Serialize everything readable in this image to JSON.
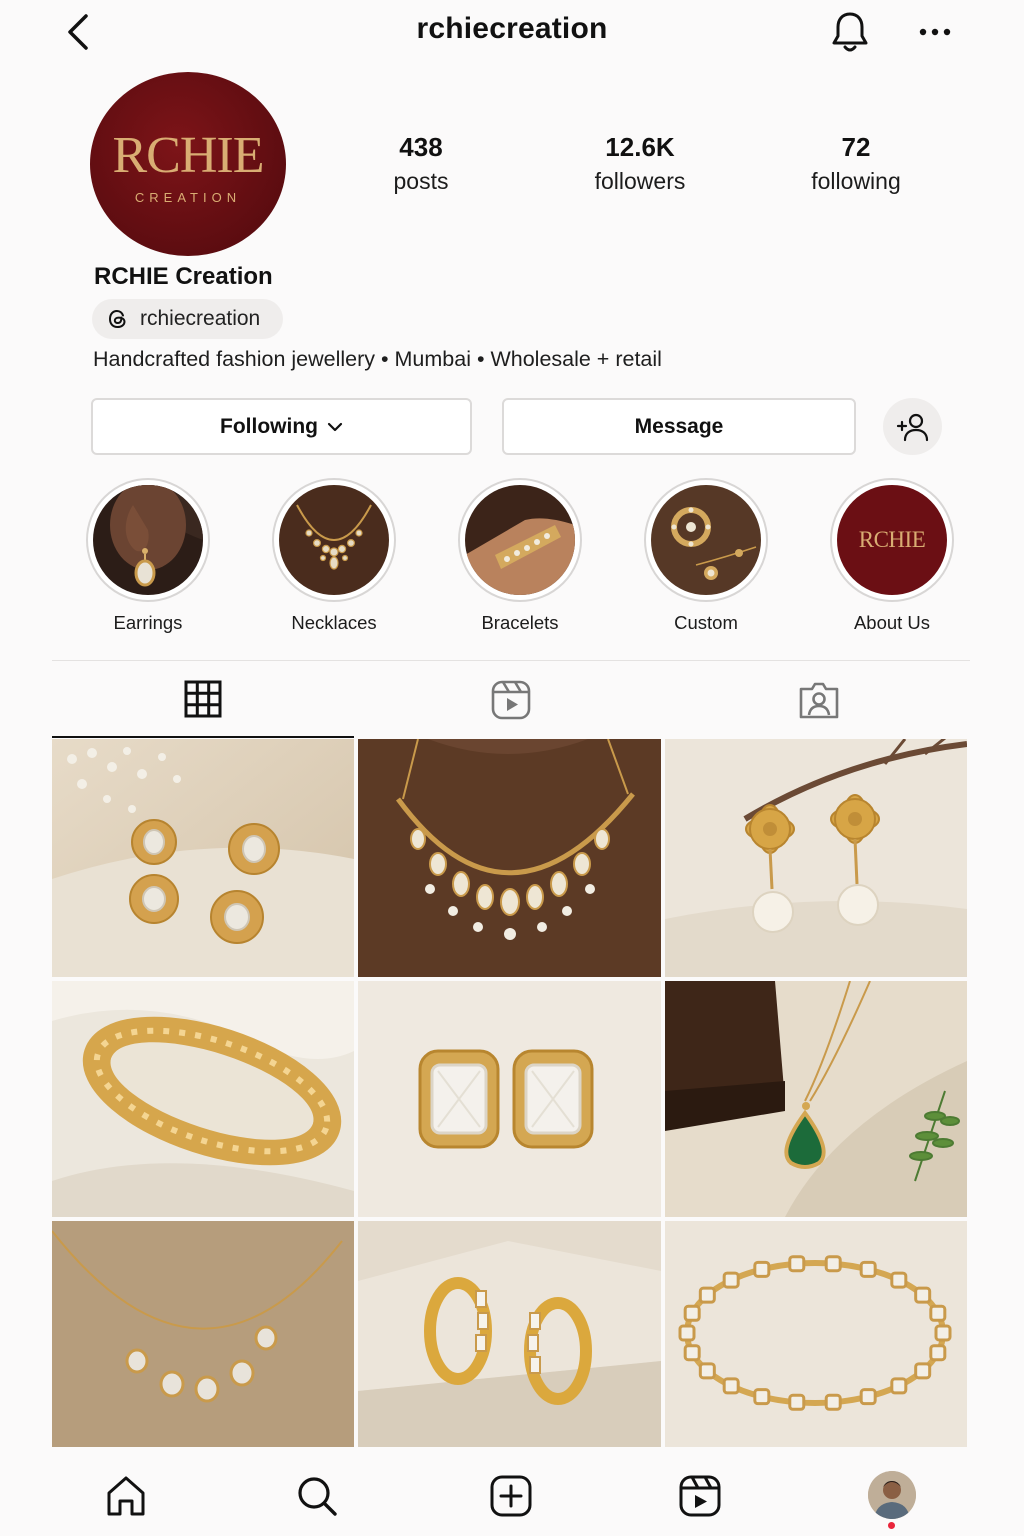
{
  "header": {
    "username": "rchiecreation",
    "icons": {
      "back": "chevron-left-icon",
      "notifications": "bell-icon",
      "more": "more-horizontal-icon"
    }
  },
  "profile": {
    "avatar_logo": {
      "main": "RCHIE",
      "sub": "CREATION"
    },
    "stats": {
      "posts": {
        "value": "438",
        "label": "posts"
      },
      "followers": {
        "value": "12.6K",
        "label": "followers"
      },
      "following": {
        "value": "72",
        "label": "following"
      }
    },
    "display_name": "RCHIE Creation",
    "threads_handle": "rchiecreation",
    "bio": "Handcrafted fashion jewellery • Mumbai • Wholesale + retail"
  },
  "actions": {
    "following_label": "Following",
    "message_label": "Message",
    "add_icon": "add-person-icon"
  },
  "highlights": [
    {
      "label": "Earrings"
    },
    {
      "label": "Necklaces"
    },
    {
      "label": "Bracelets"
    },
    {
      "label": "Custom"
    },
    {
      "label": "About Us",
      "logo_text": "RCHIE"
    }
  ],
  "tabs": [
    {
      "icon": "grid-icon",
      "active": true
    },
    {
      "icon": "reels-icon",
      "active": false
    },
    {
      "icon": "tagged-icon",
      "active": false
    }
  ],
  "posts": [
    {
      "subject": "kundan drop earrings"
    },
    {
      "subject": "pearl kundan necklace"
    },
    {
      "subject": "gold flower pearl earrings"
    },
    {
      "subject": "gold lattice bangle"
    },
    {
      "subject": "crystal halo stud earrings"
    },
    {
      "subject": "emerald pendant necklace"
    },
    {
      "subject": "crystal station necklace"
    },
    {
      "subject": "crystal hoop earrings"
    },
    {
      "subject": "kundan tennis bracelet"
    }
  ],
  "bottom_nav": [
    {
      "icon": "home-icon"
    },
    {
      "icon": "search-icon"
    },
    {
      "icon": "create-icon"
    },
    {
      "icon": "reels-icon"
    },
    {
      "icon": "profile-avatar"
    }
  ],
  "colors": {
    "brand_maroon": "#6b0f14",
    "brand_gold": "#d9ad73",
    "notification_dot": "#e9253b"
  }
}
